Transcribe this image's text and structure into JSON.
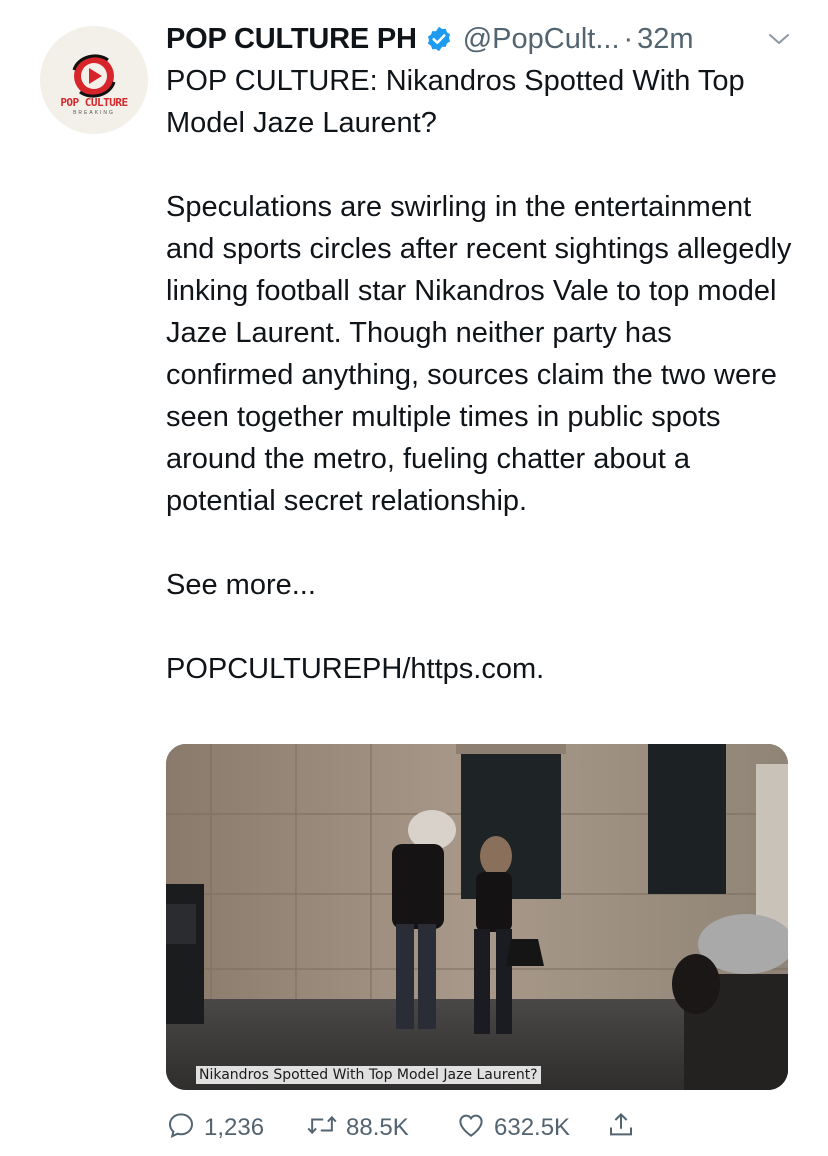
{
  "tweet": {
    "display_name": "POP CULTURE PH",
    "handle": "@PopCult...",
    "separator": "·",
    "time": "32m",
    "avatar": {
      "logo_text": "POP CULTURE",
      "logo_subtext": "BREAKING",
      "brand_color": "#d7262b"
    },
    "paragraphs": [
      "POP CULTURE: Nikandros Spotted With Top Model Jaze Laurent?",
      "Speculations are swirling in the entertainment and sports circles after recent sightings allegedly linking football star Nikandros Vale to top model Jaze Laurent. Though neither party has confirmed anything, sources claim the two were seen together multiple times in public spots around the metro, fueling chatter about a potential secret relationship.",
      "See more...",
      "POPCULTUREPH/https.com."
    ],
    "media": {
      "caption": "Nikandros Spotted With Top Model Jaze Laurent?"
    },
    "actions": {
      "replies": "1,236",
      "retweets": "88.5K",
      "likes": "632.5K"
    },
    "icons": [
      "verified-badge-icon",
      "chevron-down-icon",
      "reply-icon",
      "retweet-icon",
      "like-icon",
      "share-icon"
    ],
    "colors": {
      "verified": "#1d9bf0",
      "muted": "#536471",
      "text": "#0f1419"
    }
  }
}
